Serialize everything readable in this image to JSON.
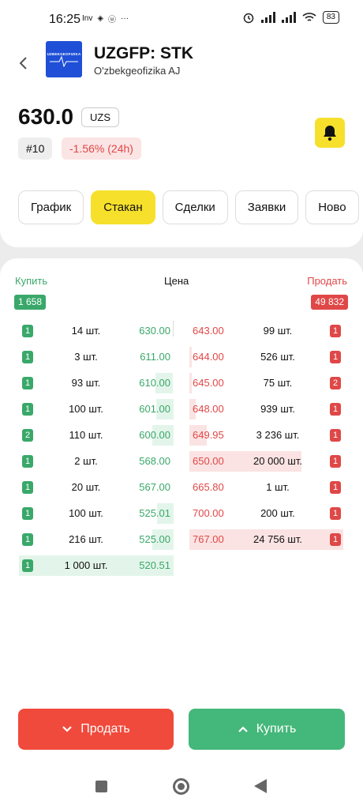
{
  "status_bar": {
    "time": "16:25",
    "left_icons": [
      "Inv",
      "◈",
      "ⓤ",
      "···"
    ],
    "battery": "83"
  },
  "header": {
    "logo_text": "UZBEKGEOFIZIKA",
    "ticker": "UZGFP: STK",
    "company": "O'zbekgeofizika AJ",
    "price": "630.0",
    "currency": "UZS",
    "rank": "#10",
    "change": "-1.56% (24h)",
    "tabs": [
      {
        "label": "График",
        "active": false
      },
      {
        "label": "Стакан",
        "active": true
      },
      {
        "label": "Сделки",
        "active": false
      },
      {
        "label": "Заявки",
        "active": false
      },
      {
        "label": "Ново",
        "active": false
      }
    ]
  },
  "orderbook": {
    "buy_label": "Купить",
    "price_label": "Цена",
    "sell_label": "Продать",
    "total_buy": "1 658",
    "total_sell": "49 832",
    "rows": [
      {
        "bid_count": "1",
        "bid_qty": "14 шт.",
        "bid_price": "630.00",
        "ask_price": "643.00",
        "ask_qty": "99 шт.",
        "ask_count": "1"
      },
      {
        "bid_count": "1",
        "bid_qty": "3 шт.",
        "bid_price": "611.00",
        "ask_price": "644.00",
        "ask_qty": "526 шт.",
        "ask_count": "1"
      },
      {
        "bid_count": "1",
        "bid_qty": "93 шт.",
        "bid_price": "610.00",
        "ask_price": "645.00",
        "ask_qty": "75 шт.",
        "ask_count": "2"
      },
      {
        "bid_count": "1",
        "bid_qty": "100 шт.",
        "bid_price": "601.00",
        "ask_price": "648.00",
        "ask_qty": "939 шт.",
        "ask_count": "1"
      },
      {
        "bid_count": "2",
        "bid_qty": "110 шт.",
        "bid_price": "600.00",
        "ask_price": "649.95",
        "ask_qty": "3 236 шт.",
        "ask_count": "1"
      },
      {
        "bid_count": "1",
        "bid_qty": "2 шт.",
        "bid_price": "568.00",
        "ask_price": "650.00",
        "ask_qty": "20 000 шт.",
        "ask_count": "1"
      },
      {
        "bid_count": "1",
        "bid_qty": "20 шт.",
        "bid_price": "567.00",
        "ask_price": "665.80",
        "ask_qty": "1 шт.",
        "ask_count": "1"
      },
      {
        "bid_count": "1",
        "bid_qty": "100 шт.",
        "bid_price": "525.01",
        "ask_price": "700.00",
        "ask_qty": "200 шт.",
        "ask_count": "1"
      },
      {
        "bid_count": "1",
        "bid_qty": "216 шт.",
        "bid_price": "525.00",
        "ask_price": "767.00",
        "ask_qty": "24 756 шт.",
        "ask_count": "1"
      },
      {
        "bid_count": "1",
        "bid_qty": "1 000 шт.",
        "bid_price": "520.51",
        "ask_price": "",
        "ask_qty": "",
        "ask_count": ""
      }
    ]
  },
  "actions": {
    "sell_label": "Продать",
    "buy_label": "Купить"
  },
  "colors": {
    "accent_yellow": "#f6e02c",
    "buy_green": "#3aa86a",
    "sell_red": "#e04747"
  }
}
